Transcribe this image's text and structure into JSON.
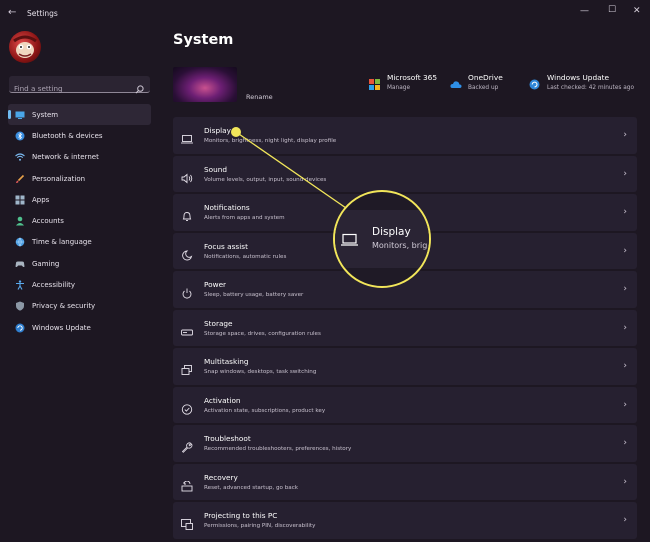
{
  "window": {
    "title": "Settings"
  },
  "search": {
    "placeholder": "Find a setting"
  },
  "sidebar": {
    "items": [
      {
        "label": "System",
        "icon": "monitor-icon",
        "active": true
      },
      {
        "label": "Bluetooth & devices",
        "icon": "bluetooth-icon"
      },
      {
        "label": "Network & internet",
        "icon": "wifi-icon"
      },
      {
        "label": "Personalization",
        "icon": "brush-icon"
      },
      {
        "label": "Apps",
        "icon": "apps-icon"
      },
      {
        "label": "Accounts",
        "icon": "person-icon"
      },
      {
        "label": "Time & language",
        "icon": "globe-icon"
      },
      {
        "label": "Gaming",
        "icon": "gamepad-icon"
      },
      {
        "label": "Accessibility",
        "icon": "accessibility-icon"
      },
      {
        "label": "Privacy & security",
        "icon": "shield-icon"
      },
      {
        "label": "Windows Update",
        "icon": "update-icon"
      }
    ]
  },
  "main": {
    "title": "System",
    "rename_label": "Rename",
    "services": [
      {
        "name": "Microsoft 365",
        "sub": "Manage",
        "icon": "office-icon"
      },
      {
        "name": "OneDrive",
        "sub": "Backed up",
        "icon": "cloud-icon"
      },
      {
        "name": "Windows Update",
        "sub": "Last checked: 42 minutes ago",
        "icon": "update-icon"
      }
    ],
    "settings": [
      {
        "title": "Display",
        "sub": "Monitors, brightness, night light, display profile",
        "icon": "laptop-icon"
      },
      {
        "title": "Sound",
        "sub": "Volume levels, output, input, sound devices",
        "icon": "speaker-icon"
      },
      {
        "title": "Notifications",
        "sub": "Alerts from apps and system",
        "icon": "bell-icon"
      },
      {
        "title": "Focus assist",
        "sub": "Notifications, automatic rules",
        "icon": "moon-icon"
      },
      {
        "title": "Power",
        "sub": "Sleep, battery usage, battery saver",
        "icon": "power-icon"
      },
      {
        "title": "Storage",
        "sub": "Storage space, drives, configuration rules",
        "icon": "drive-icon"
      },
      {
        "title": "Multitasking",
        "sub": "Snap windows, desktops, task switching",
        "icon": "multitask-icon"
      },
      {
        "title": "Activation",
        "sub": "Activation state, subscriptions, product key",
        "icon": "check-circle-icon"
      },
      {
        "title": "Troubleshoot",
        "sub": "Recommended troubleshooters, preferences, history",
        "icon": "wrench-icon"
      },
      {
        "title": "Recovery",
        "sub": "Reset, advanced startup, go back",
        "icon": "recovery-icon"
      },
      {
        "title": "Projecting to this PC",
        "sub": "Permissions, pairing PIN, discoverability",
        "icon": "project-icon"
      }
    ]
  },
  "callout": {
    "title": "Display",
    "sub": "Monitors, brig"
  },
  "colors": {
    "accent": "#6fbaf0",
    "highlight": "#f2e65a",
    "background": "#1d1722",
    "card": "#262030"
  }
}
